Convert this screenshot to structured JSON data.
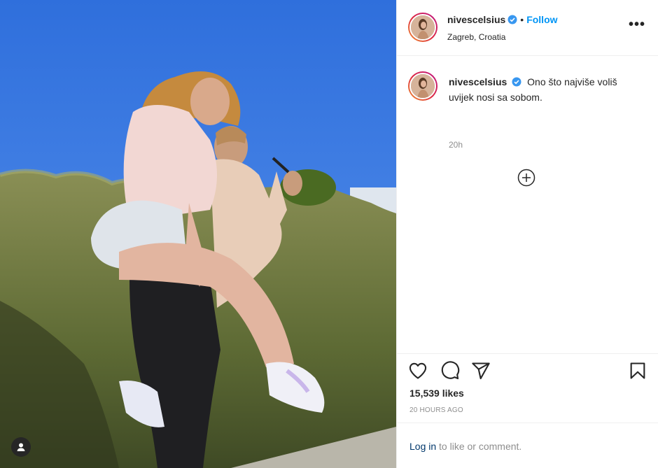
{
  "post": {
    "username": "nivescelsius",
    "location": "Zagreb, Croatia",
    "follow_label": "Follow",
    "separator": "•",
    "more_label": "•••",
    "caption": "Ono što najviše voliš uvijek nosi sa sobom.",
    "caption_time": "20h",
    "likes": "15,539 likes",
    "timestamp": "20 HOURS AGO",
    "login_link": "Log in",
    "login_rest": " to like or comment."
  },
  "icons": {
    "verified": "verified-badge-icon",
    "more": "more-options-icon",
    "load_more": "plus-circle-icon",
    "like": "heart-icon",
    "comment": "comment-icon",
    "share": "share-icon",
    "save": "bookmark-icon",
    "tagged": "user-tag-icon"
  },
  "colors": {
    "accent": "#0095f6",
    "verified": "#3897f0",
    "muted": "#8e8e8e",
    "text": "#262626",
    "sky": "#3f7fe6",
    "hedge": "#6d7a3e"
  }
}
